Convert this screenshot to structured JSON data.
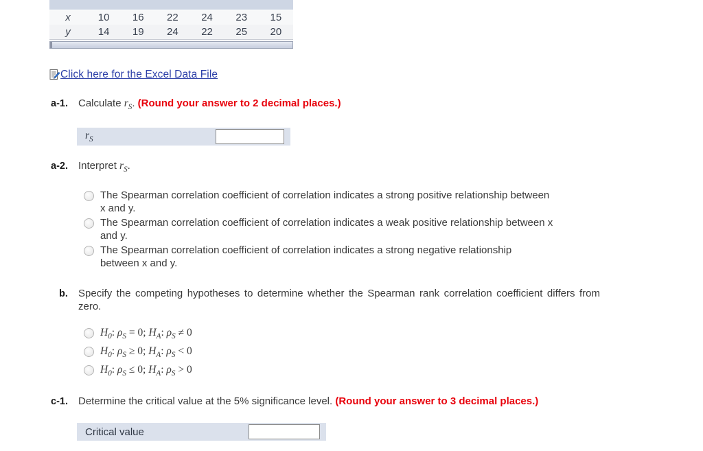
{
  "data_table": {
    "rows": [
      {
        "label": "x",
        "values": [
          "10",
          "16",
          "22",
          "24",
          "23",
          "15"
        ]
      },
      {
        "label": "y",
        "values": [
          "14",
          "19",
          "24",
          "22",
          "25",
          "20"
        ]
      }
    ]
  },
  "excel_link": {
    "icon": "excel-document-icon",
    "text": "Click here for the Excel Data File"
  },
  "questions": {
    "a1": {
      "label": "a-1.",
      "text_plain": "Calculate ",
      "symbol": "rS",
      "text_after": ".",
      "instruction": "(Round your answer to 2 decimal places.)",
      "answer_row": {
        "cell_label": "rS",
        "value": "",
        "placeholder": ""
      }
    },
    "a2": {
      "label": "a-2.",
      "text_plain": "Interpret ",
      "symbol": "rS",
      "text_after": ".",
      "options": [
        "The Spearman correlation coefficient of correlation indicates a strong positive relationship between x and y.",
        "The Spearman correlation coefficient of correlation indicates a weak positive relationship between x and y.",
        "The Spearman correlation coefficient of correlation indicates a strong negative relationship between x and y."
      ]
    },
    "b": {
      "label": "b.",
      "text": "Specify the competing hypotheses to determine whether the Spearman rank correlation coefficient differs from zero.",
      "options": [
        "H0: ρS = 0; HA: ρS ≠ 0",
        "H0: ρS ≥ 0; HA: ρS < 0",
        "H0: ρS ≤ 0; HA: ρS > 0"
      ],
      "options_parts": [
        {
          "null_rel": "=",
          "alt_rel": "≠",
          "null_val": "0",
          "alt_val": "0"
        },
        {
          "null_rel": "≥",
          "alt_rel": "<",
          "null_val": "0",
          "alt_val": "0"
        },
        {
          "null_rel": "≤",
          "alt_rel": ">",
          "null_val": "0",
          "alt_val": "0"
        }
      ]
    },
    "c1": {
      "label": "c-1.",
      "text": "Determine the critical value at the 5% significance level.",
      "instruction": "(Round your answer to 3 decimal places.)",
      "answer_row": {
        "cell_label": "Critical value",
        "value": "",
        "placeholder": ""
      }
    }
  },
  "colors": {
    "link": "#2c3fa8",
    "instruction_red": "#e8020c",
    "answer_band": "#dbe1ec",
    "table_header_band": "#ced6e4",
    "page_background": "#ffffff"
  }
}
